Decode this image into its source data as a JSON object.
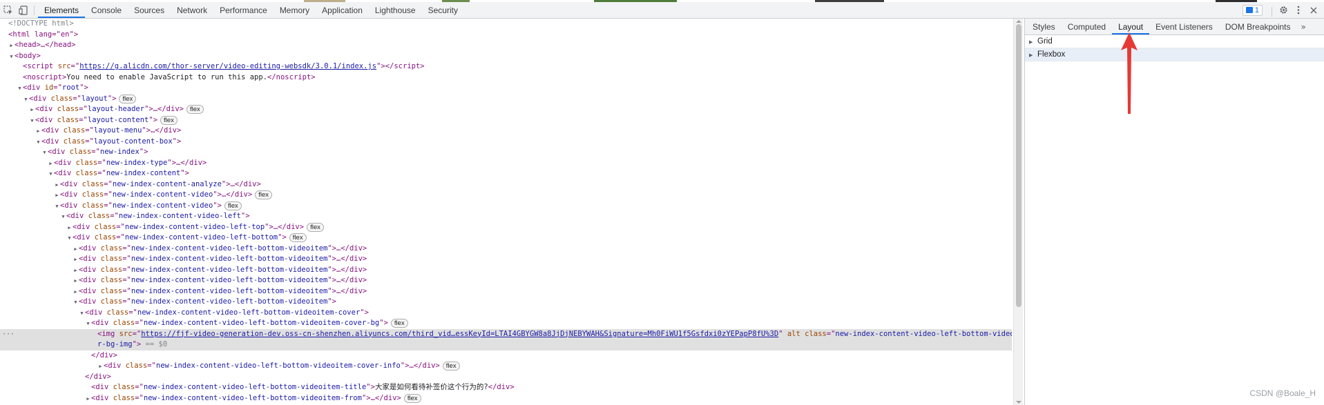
{
  "devtools": {
    "tabs": [
      "Elements",
      "Console",
      "Sources",
      "Network",
      "Performance",
      "Memory",
      "Application",
      "Lighthouse",
      "Security"
    ],
    "active_tab": "Elements",
    "issues_count": "1",
    "sidebar_tabs": [
      "Styles",
      "Computed",
      "Layout",
      "Event Listeners",
      "DOM Breakpoints"
    ],
    "sidebar_more": "»",
    "sidebar_active": "Layout",
    "sections": [
      "Grid",
      "Flexbox"
    ]
  },
  "dom": {
    "doctype": "<!DOCTYPE html>",
    "html_open": "<html lang=\"en\">",
    "head": "<head>…</head>",
    "body_open": "<body>",
    "script_src": "https://g.alicdn.com/thor-server/video-editing-websdk/3.0.1/index.js",
    "noscript_text": "You need to enable JavaScript to run this app.",
    "root_id": "root",
    "classes": {
      "layout": "layout",
      "layout_header": "layout-header",
      "layout_content": "layout-content",
      "layout_menu": "layout-menu",
      "layout_content_box": "layout-content-box",
      "new_index": "new-index",
      "new_index_type": "new-index-type",
      "new_index_content": "new-index-content",
      "analyze": "new-index-content-analyze",
      "video": "new-index-content-video",
      "video_left": "new-index-content-video-left",
      "left_top": "new-index-content-video-left-top",
      "left_bottom": "new-index-content-video-left-bottom",
      "videoitem": "new-index-content-video-left-bottom-videoitem",
      "cover": "new-index-content-video-left-bottom-videoitem-cover",
      "cover_bg": "new-index-content-video-left-bottom-videoitem-cover-bg",
      "cover_bg_img_a": "new-index-content-video-left-bottom-videoitem-cove",
      "cover_bg_img_b": "r-bg-img",
      "cover_info": "new-index-content-video-left-bottom-videoitem-cover-info",
      "title": "new-index-content-video-left-bottom-videoitem-title",
      "from": "new-index-content-video-left-bottom-videoitem-from"
    },
    "img_src": "https://fjf-video-generation-dev.oss-cn-shenzhen.aliyuncs.com/third_vid…essKeyId=LTAI4GBYGW8a8JjDjNEBYWAH&Signature=Mh0FiWU1f5Gsfdxi0zYEPapP8fU%3D",
    "selected_eq": "== $0",
    "title_text": "大家是如何看待补签价这个行为的?",
    "flex_badge": "flex"
  },
  "watermark": "CSDN @Boale_H",
  "annotation_color": "#e53935"
}
